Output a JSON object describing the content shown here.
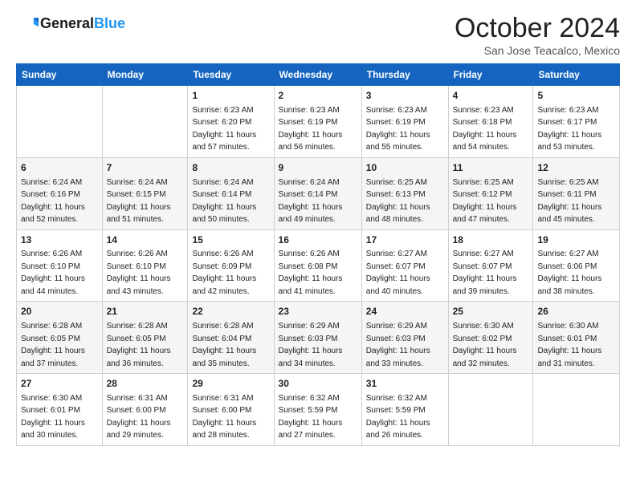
{
  "header": {
    "logo_line1": "General",
    "logo_line2": "Blue",
    "title": "October 2024",
    "location": "San Jose Teacalco, Mexico"
  },
  "days_of_week": [
    "Sunday",
    "Monday",
    "Tuesday",
    "Wednesday",
    "Thursday",
    "Friday",
    "Saturday"
  ],
  "weeks": [
    [
      {
        "day": "",
        "empty": true
      },
      {
        "day": "",
        "empty": true
      },
      {
        "day": "1",
        "sunrise": "6:23 AM",
        "sunset": "6:20 PM",
        "daylight": "11 hours and 57 minutes."
      },
      {
        "day": "2",
        "sunrise": "6:23 AM",
        "sunset": "6:19 PM",
        "daylight": "11 hours and 56 minutes."
      },
      {
        "day": "3",
        "sunrise": "6:23 AM",
        "sunset": "6:19 PM",
        "daylight": "11 hours and 55 minutes."
      },
      {
        "day": "4",
        "sunrise": "6:23 AM",
        "sunset": "6:18 PM",
        "daylight": "11 hours and 54 minutes."
      },
      {
        "day": "5",
        "sunrise": "6:23 AM",
        "sunset": "6:17 PM",
        "daylight": "11 hours and 53 minutes."
      }
    ],
    [
      {
        "day": "6",
        "sunrise": "6:24 AM",
        "sunset": "6:16 PM",
        "daylight": "11 hours and 52 minutes."
      },
      {
        "day": "7",
        "sunrise": "6:24 AM",
        "sunset": "6:15 PM",
        "daylight": "11 hours and 51 minutes."
      },
      {
        "day": "8",
        "sunrise": "6:24 AM",
        "sunset": "6:14 PM",
        "daylight": "11 hours and 50 minutes."
      },
      {
        "day": "9",
        "sunrise": "6:24 AM",
        "sunset": "6:14 PM",
        "daylight": "11 hours and 49 minutes."
      },
      {
        "day": "10",
        "sunrise": "6:25 AM",
        "sunset": "6:13 PM",
        "daylight": "11 hours and 48 minutes."
      },
      {
        "day": "11",
        "sunrise": "6:25 AM",
        "sunset": "6:12 PM",
        "daylight": "11 hours and 47 minutes."
      },
      {
        "day": "12",
        "sunrise": "6:25 AM",
        "sunset": "6:11 PM",
        "daylight": "11 hours and 45 minutes."
      }
    ],
    [
      {
        "day": "13",
        "sunrise": "6:26 AM",
        "sunset": "6:10 PM",
        "daylight": "11 hours and 44 minutes."
      },
      {
        "day": "14",
        "sunrise": "6:26 AM",
        "sunset": "6:10 PM",
        "daylight": "11 hours and 43 minutes."
      },
      {
        "day": "15",
        "sunrise": "6:26 AM",
        "sunset": "6:09 PM",
        "daylight": "11 hours and 42 minutes."
      },
      {
        "day": "16",
        "sunrise": "6:26 AM",
        "sunset": "6:08 PM",
        "daylight": "11 hours and 41 minutes."
      },
      {
        "day": "17",
        "sunrise": "6:27 AM",
        "sunset": "6:07 PM",
        "daylight": "11 hours and 40 minutes."
      },
      {
        "day": "18",
        "sunrise": "6:27 AM",
        "sunset": "6:07 PM",
        "daylight": "11 hours and 39 minutes."
      },
      {
        "day": "19",
        "sunrise": "6:27 AM",
        "sunset": "6:06 PM",
        "daylight": "11 hours and 38 minutes."
      }
    ],
    [
      {
        "day": "20",
        "sunrise": "6:28 AM",
        "sunset": "6:05 PM",
        "daylight": "11 hours and 37 minutes."
      },
      {
        "day": "21",
        "sunrise": "6:28 AM",
        "sunset": "6:05 PM",
        "daylight": "11 hours and 36 minutes."
      },
      {
        "day": "22",
        "sunrise": "6:28 AM",
        "sunset": "6:04 PM",
        "daylight": "11 hours and 35 minutes."
      },
      {
        "day": "23",
        "sunrise": "6:29 AM",
        "sunset": "6:03 PM",
        "daylight": "11 hours and 34 minutes."
      },
      {
        "day": "24",
        "sunrise": "6:29 AM",
        "sunset": "6:03 PM",
        "daylight": "11 hours and 33 minutes."
      },
      {
        "day": "25",
        "sunrise": "6:30 AM",
        "sunset": "6:02 PM",
        "daylight": "11 hours and 32 minutes."
      },
      {
        "day": "26",
        "sunrise": "6:30 AM",
        "sunset": "6:01 PM",
        "daylight": "11 hours and 31 minutes."
      }
    ],
    [
      {
        "day": "27",
        "sunrise": "6:30 AM",
        "sunset": "6:01 PM",
        "daylight": "11 hours and 30 minutes."
      },
      {
        "day": "28",
        "sunrise": "6:31 AM",
        "sunset": "6:00 PM",
        "daylight": "11 hours and 29 minutes."
      },
      {
        "day": "29",
        "sunrise": "6:31 AM",
        "sunset": "6:00 PM",
        "daylight": "11 hours and 28 minutes."
      },
      {
        "day": "30",
        "sunrise": "6:32 AM",
        "sunset": "5:59 PM",
        "daylight": "11 hours and 27 minutes."
      },
      {
        "day": "31",
        "sunrise": "6:32 AM",
        "sunset": "5:59 PM",
        "daylight": "11 hours and 26 minutes."
      },
      {
        "day": "",
        "empty": true
      },
      {
        "day": "",
        "empty": true
      }
    ]
  ],
  "labels": {
    "sunrise": "Sunrise:",
    "sunset": "Sunset:",
    "daylight": "Daylight:"
  }
}
